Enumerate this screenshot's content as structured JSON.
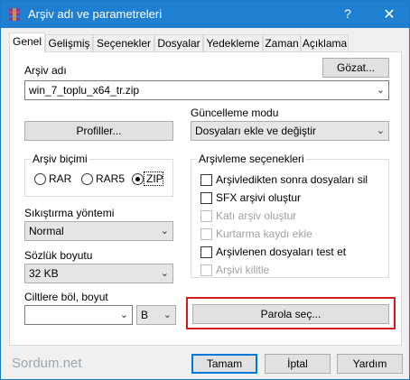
{
  "window": {
    "title": "Arşiv adı ve parametreleri",
    "help_glyph": "?",
    "close_glyph": "✕"
  },
  "tabs": [
    "Genel",
    "Gelişmiş",
    "Seçenekler",
    "Dosyalar",
    "Yedekleme",
    "Zaman",
    "Açıklama"
  ],
  "general": {
    "archive_name_label": "Arşiv adı",
    "browse_button": "Gözat...",
    "archive_name_value": "win_7_toplu_x64_tr.zip",
    "profiles_button": "Profiller...",
    "update_mode_label": "Güncelleme modu",
    "update_mode_value": "Dosyaları ekle ve değiştir",
    "format_group": "Arşiv biçimi",
    "format_rar": "RAR",
    "format_rar5": "RAR5",
    "format_zip": "ZIP",
    "format_selected": "ZIP",
    "compression_label": "Sıkıştırma yöntemi",
    "compression_value": "Normal",
    "dictionary_label": "Sözlük boyutu",
    "dictionary_value": "32 KB",
    "split_label": "Ciltlere böl, boyut",
    "split_value": "",
    "split_unit": "B",
    "options_group": "Arşivleme seçenekleri",
    "options": [
      {
        "label": "Arşivledikten sonra dosyaları sil",
        "checked": false,
        "enabled": true
      },
      {
        "label": "SFX arşivi oluştur",
        "checked": false,
        "enabled": true
      },
      {
        "label": "Katı arşiv oluştur",
        "checked": false,
        "enabled": false
      },
      {
        "label": "Kurtarma kaydı ekle",
        "checked": false,
        "enabled": false
      },
      {
        "label": "Arşivlenen dosyaları test et",
        "checked": false,
        "enabled": true
      },
      {
        "label": "Arşivi kilitle",
        "checked": false,
        "enabled": false
      }
    ],
    "password_button": "Parola seç..."
  },
  "footer": {
    "watermark": "Sordum.net",
    "ok_button": "Tamam",
    "cancel_button": "İptal",
    "help_button": "Yardım"
  },
  "colors": {
    "titlebar": "#1f7fd1",
    "highlight": "#d11a1a",
    "accent": "#0078d7"
  }
}
